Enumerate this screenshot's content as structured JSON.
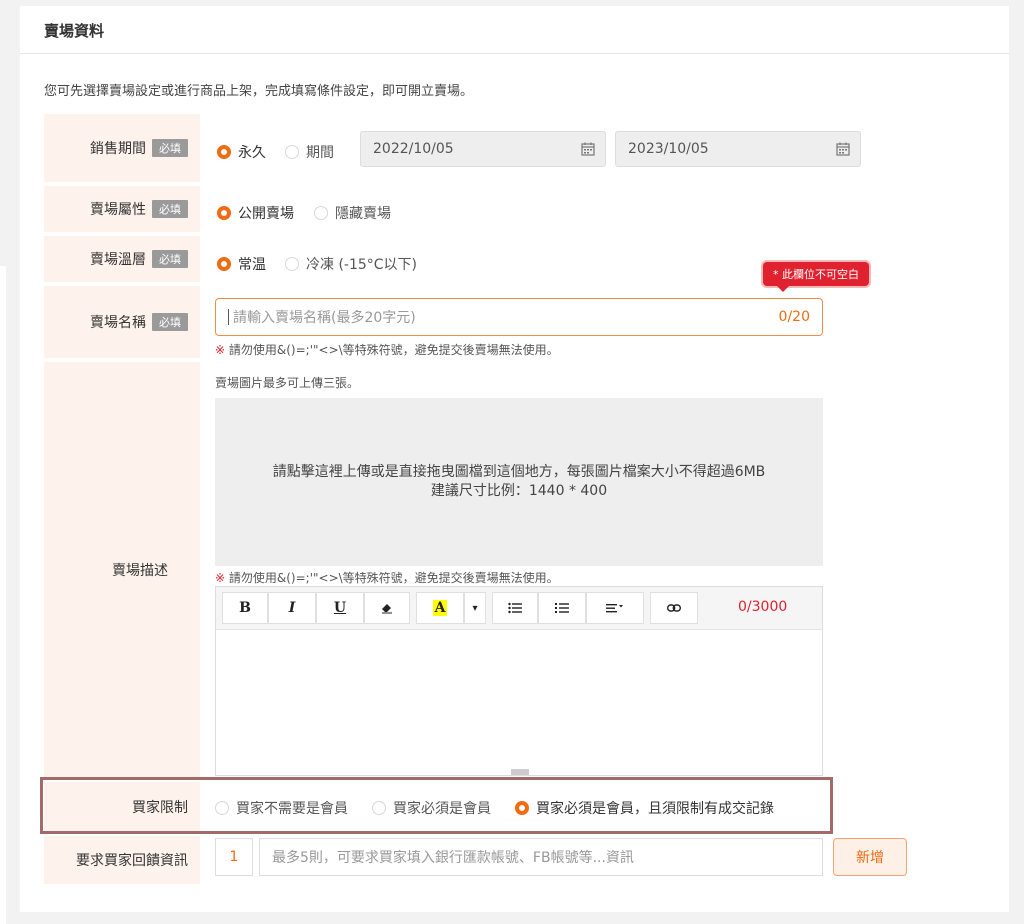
{
  "section": {
    "title": "賣場資料",
    "intro": "您可先選擇賣場設定或進行商品上架，完成填寫條件設定，即可開立賣場。",
    "required_badge": "必填"
  },
  "sale_period": {
    "label": "銷售期間",
    "options": [
      "永久",
      "期間"
    ],
    "selected": "永久",
    "start_date": "2022/10/05",
    "end_date": "2023/10/05"
  },
  "attribute": {
    "label": "賣場屬性",
    "options": [
      "公開賣場",
      "隱藏賣場"
    ],
    "selected": "公開賣場"
  },
  "temperature": {
    "label": "賣場溫層",
    "options": [
      "常温",
      "冷凍 (-15°C以下)"
    ],
    "selected": "常温"
  },
  "store_name": {
    "label": "賣場名稱",
    "placeholder": "請輸入賣場名稱(最多20字元)",
    "counter": "0/20",
    "error_tip": "* 此欄位不可空白",
    "warning_mark": "※",
    "warning": "請勿使用&()=;'\"<>\\等特殊符號，避免提交後賣場無法使用。"
  },
  "description": {
    "label": "賣場描述",
    "image_note": "賣場圖片最多可上傳三張。",
    "upload_line1": "請點擊這裡上傳或是直接拖曳圖檔到這個地方，每張圖片檔案大小不得超過6MB",
    "upload_line2": "建議尺寸比例：1440 * 400",
    "warning_mark": "※",
    "warning": "請勿使用&()=;'\"<>\\等特殊符號，避免提交後賣場無法使用。",
    "toolbar": {
      "bold": "B",
      "italic": "I",
      "underline": "U",
      "font_color": "A",
      "dropdown_arrow": "▾",
      "counter": "0/3000"
    }
  },
  "buyer_limit": {
    "label": "買家限制",
    "options": [
      "買家不需要是會員",
      "買家必須是會員",
      "買家必須是會員，且須限制有成交記錄"
    ],
    "selected": "買家必須是會員，且須限制有成交記錄"
  },
  "feedback": {
    "label": "要求買家回饋資訊",
    "count": "1",
    "placeholder": "最多5則，可要求買家填入銀行匯款帳號、FB帳號等...資訊",
    "add_button": "新增"
  },
  "colors": {
    "accent": "#f26a12",
    "error": "#e0212f",
    "label_bg": "#fdf3ec"
  }
}
